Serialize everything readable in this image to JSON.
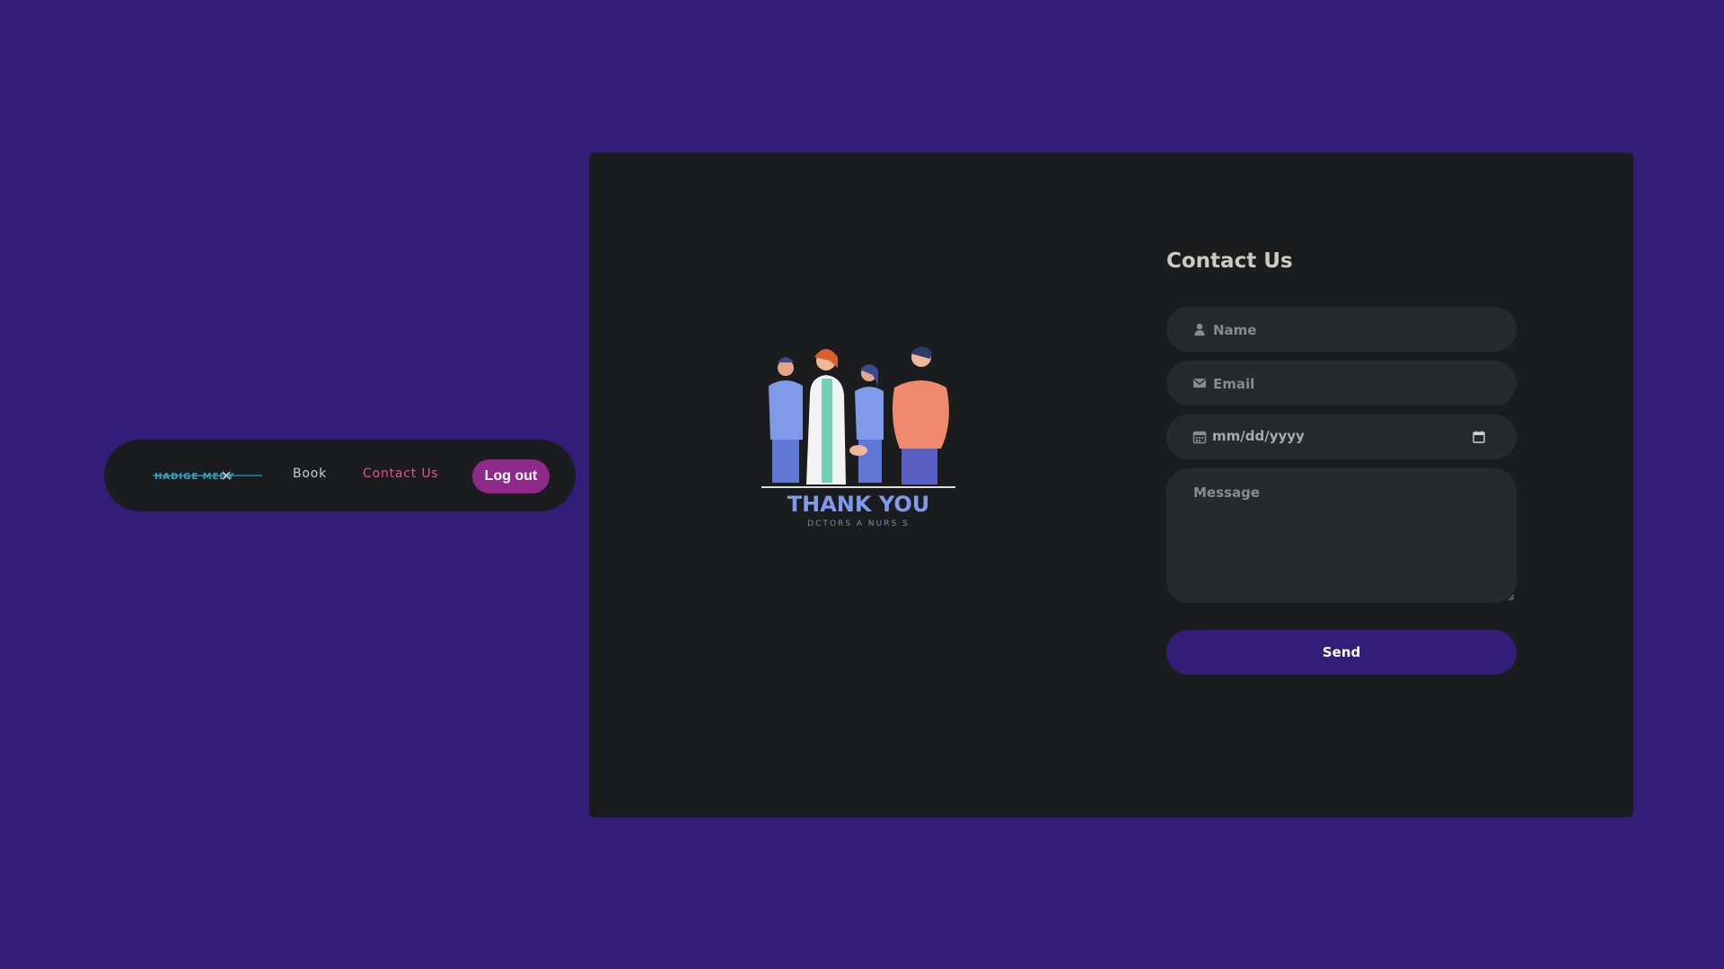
{
  "nav": {
    "logo_alt": "logo",
    "book_label": "Book",
    "contact_label": "Contact Us",
    "logout_label": "Log out"
  },
  "illustration": {
    "title": "THANK YOU",
    "subtitle": "DCTORS A   NURS  S"
  },
  "form": {
    "title": "Contact Us",
    "name_placeholder": "Name",
    "email_placeholder": "Email",
    "date_placeholder": "mm/dd/yyyy",
    "message_placeholder": "Message",
    "send_label": "Send"
  },
  "colors": {
    "background": "#321e78",
    "card": "#1b1c1d",
    "field": "#27292a",
    "accent_link": "#e0508f",
    "logout": "#8f2a8a",
    "send": "#321e78"
  },
  "icons": {
    "name": "user-icon",
    "email": "envelope-icon",
    "date": "calendar-icon",
    "date_picker": "calendar-picker-icon"
  }
}
